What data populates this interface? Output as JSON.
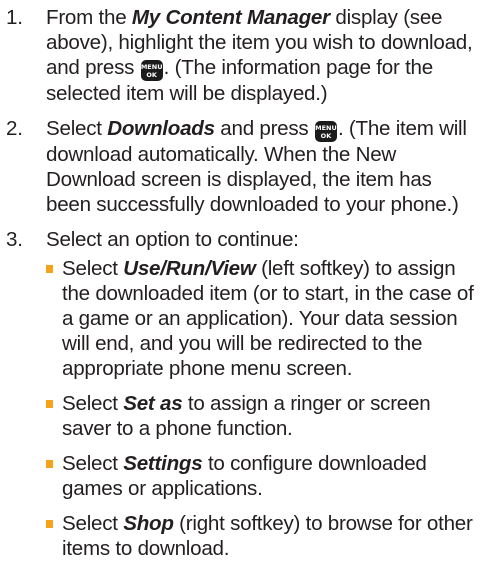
{
  "steps": [
    {
      "number": "1.",
      "text_a": "From the ",
      "em_a": "My Content Manager",
      "text_b": " display (see above), highlight the item you wish to download, and press ",
      "text_c": ". (The information page for the selected item will be displayed.)"
    },
    {
      "number": "2.",
      "text_a": "Select ",
      "em_a": "Downloads",
      "text_b": " and press ",
      "text_c": ". (The item will download automatically. When the New Download screen is displayed, the item has been successfully downloaded to your phone.)"
    },
    {
      "number": "3.",
      "text_a": "Select an option to continue:"
    }
  ],
  "key": {
    "top": "MENU",
    "bottom": "OK",
    "icon": "menu-ok-key-icon"
  },
  "options": [
    {
      "pre": "Select ",
      "em": "Use/Run/View",
      "post": " (left softkey) to assign the downloaded item (or to start, in the case of a game or an application). Your data session will end, and you will be redirected to the appropriate phone menu screen."
    },
    {
      "pre": "Select ",
      "em": "Set as",
      "post": " to assign a ringer or screen saver to a phone function."
    },
    {
      "pre": "Select ",
      "em": "Settings",
      "post": " to configure downloaded games or applications."
    },
    {
      "pre": "Select ",
      "em": "Shop",
      "post": " (right softkey) to browse for other items to download."
    }
  ],
  "colors": {
    "text": "#231f20",
    "bullet": "#f7a21b",
    "key_background": "#1b1b1b"
  }
}
